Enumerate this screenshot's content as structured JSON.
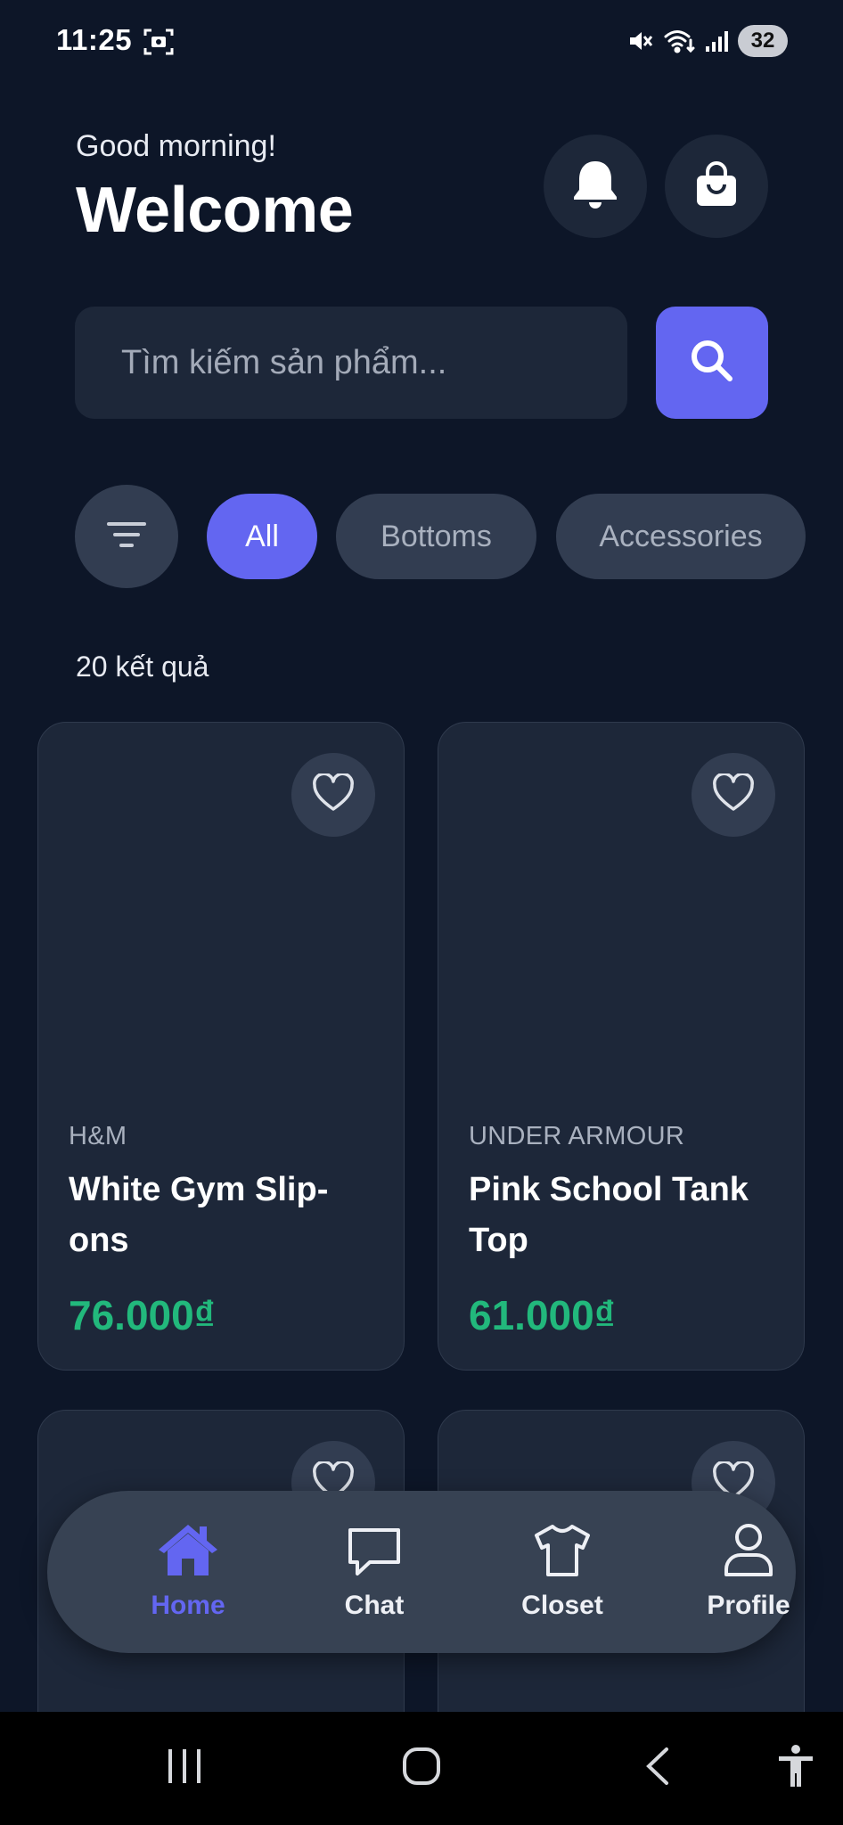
{
  "status_bar": {
    "time": "11:25",
    "battery": "32"
  },
  "header": {
    "greeting": "Good morning!",
    "title": "Welcome"
  },
  "search": {
    "placeholder": "Tìm kiếm sản phẩm..."
  },
  "chips": [
    {
      "label": "All",
      "selected": true
    },
    {
      "label": "Bottoms",
      "selected": false
    },
    {
      "label": "Accessories",
      "selected": false
    }
  ],
  "results_text": "20 kết quả",
  "products": [
    {
      "brand": "H&M",
      "name": "White Gym Slip-ons",
      "price": "76.000₫"
    },
    {
      "brand": "UNDER ARMOUR",
      "name": "Pink School Tank Top",
      "price": "61.000₫"
    }
  ],
  "bottom_nav": [
    {
      "label": "Home",
      "icon": "home-icon",
      "active": true
    },
    {
      "label": "Chat",
      "icon": "chat-icon",
      "active": false
    },
    {
      "label": "Closet",
      "icon": "shirt-icon",
      "active": false
    },
    {
      "label": "Profile",
      "icon": "profile-icon",
      "active": false
    }
  ],
  "colors": {
    "background": "#0d1628",
    "surface": "#1d2739",
    "accent": "#6366f1",
    "price": "#22b87c"
  }
}
